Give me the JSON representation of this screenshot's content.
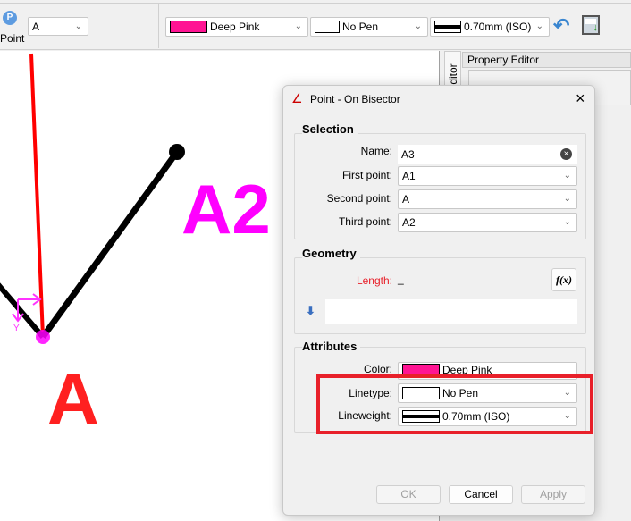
{
  "toolbar": {
    "point_tool_label": "Point",
    "point_select": "A",
    "color": {
      "label": "Deep Pink",
      "swatch": "#ff1493"
    },
    "linetype": "No Pen",
    "lineweight": "0.70mm (ISO)",
    "undo_icon": "undo-arrow-icon",
    "save_icon": "save-icon"
  },
  "side_panel": {
    "vertical_tab": "Editor",
    "title": "Property Editor"
  },
  "canvas": {
    "labels": [
      "A2",
      "A"
    ],
    "axis_y": "Y",
    "colors": {
      "label_a2": "#ff00ff",
      "label_a": "#ff2020",
      "red_line": "#ff0000",
      "black_line": "#000000"
    }
  },
  "dialog": {
    "title": "Point - On Bisector",
    "selection": {
      "title": "Selection",
      "name_label": "Name:",
      "name_value": "A3",
      "first_label": "First point:",
      "first_value": "A1",
      "second_label": "Second point:",
      "second_value": "A",
      "third_label": "Third point:",
      "third_value": "A2"
    },
    "geometry": {
      "title": "Geometry",
      "length_label": "Length:",
      "length_value": "_",
      "formula_button": "f(x)"
    },
    "attributes": {
      "title": "Attributes",
      "color_label": "Color:",
      "color_value": "Deep Pink",
      "linetype_label": "Linetype:",
      "linetype_value": "No Pen",
      "lineweight_label": "Lineweight:",
      "lineweight_value": "0.70mm (ISO)"
    },
    "buttons": {
      "ok": "OK",
      "cancel": "Cancel",
      "apply": "Apply"
    },
    "highlight_color": "#e8202a"
  }
}
